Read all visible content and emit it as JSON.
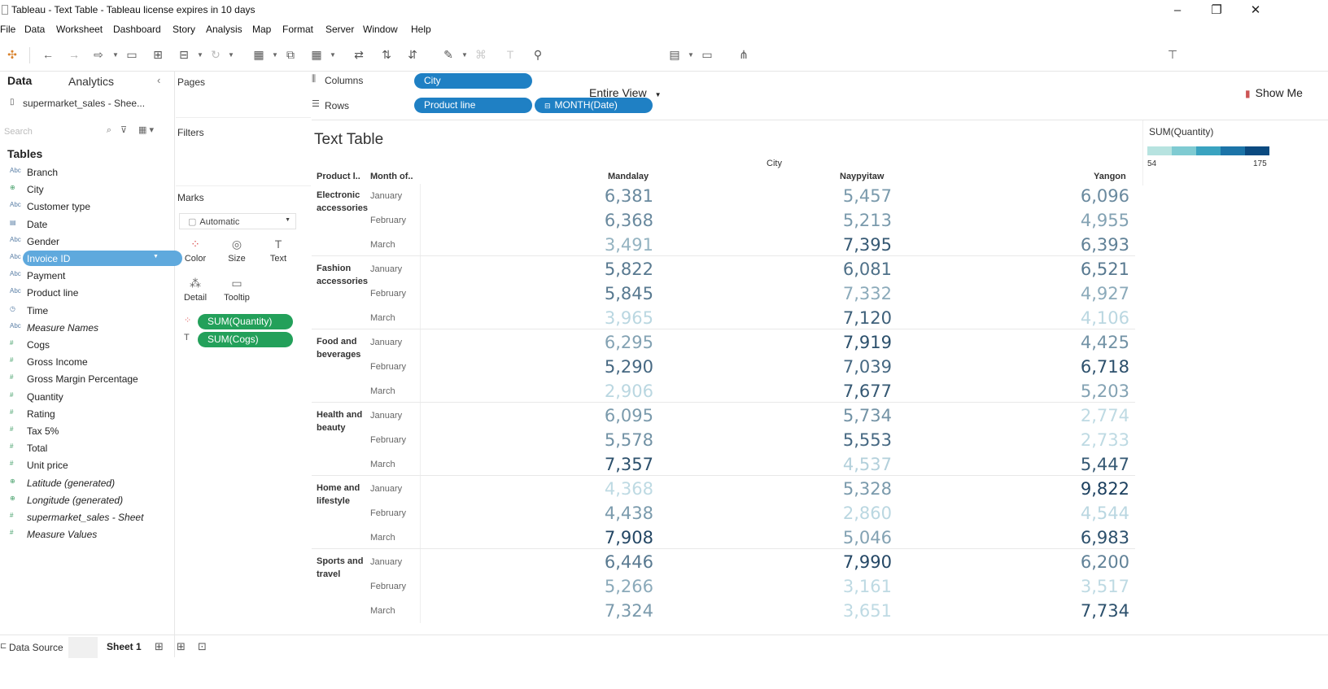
{
  "window": {
    "title": "Tableau - Text Table - Tableau license expires in 10 days",
    "minimize": "–",
    "restore": "❐",
    "close": "✕"
  },
  "menu": [
    "File",
    "Data",
    "Worksheet",
    "Dashboard",
    "Story",
    "Analysis",
    "Map",
    "Format",
    "Server",
    "Window",
    "Help"
  ],
  "toolbar": {
    "fit_label": "Entire View",
    "show_me_label": "Show Me"
  },
  "data_pane": {
    "tab_data": "Data",
    "tab_analytics": "Analytics",
    "collapse": "‹",
    "source": "supermarket_sales - Shee...",
    "search_placeholder": "Search",
    "tables_label": "Tables",
    "fields": [
      {
        "icon": "Abc",
        "label": "Branch",
        "kind": "dimension"
      },
      {
        "icon": "⊕",
        "label": "City",
        "kind": "geo"
      },
      {
        "icon": "Abc",
        "label": "Customer type",
        "kind": "dimension"
      },
      {
        "icon": "▤",
        "label": "Date",
        "kind": "date"
      },
      {
        "icon": "Abc",
        "label": "Gender",
        "kind": "dimension"
      },
      {
        "icon": "Abc",
        "label": "Invoice ID",
        "kind": "dimension",
        "selected": true
      },
      {
        "icon": "Abc",
        "label": "Payment",
        "kind": "dimension"
      },
      {
        "icon": "Abc",
        "label": "Product line",
        "kind": "dimension"
      },
      {
        "icon": "◷",
        "label": "Time",
        "kind": "date"
      },
      {
        "icon": "Abc",
        "label": "Measure Names",
        "kind": "dimension",
        "italic": true
      },
      {
        "icon": "#",
        "label": "Cogs",
        "kind": "measure"
      },
      {
        "icon": "#",
        "label": "Gross Income",
        "kind": "measure"
      },
      {
        "icon": "#",
        "label": "Gross Margin Percentage",
        "kind": "measure"
      },
      {
        "icon": "#",
        "label": "Quantity",
        "kind": "measure"
      },
      {
        "icon": "#",
        "label": "Rating",
        "kind": "measure"
      },
      {
        "icon": "#",
        "label": "Tax 5%",
        "kind": "measure"
      },
      {
        "icon": "#",
        "label": "Total",
        "kind": "measure"
      },
      {
        "icon": "#",
        "label": "Unit price",
        "kind": "measure"
      },
      {
        "icon": "⊕",
        "label": "Latitude (generated)",
        "kind": "geo",
        "italic": true
      },
      {
        "icon": "⊕",
        "label": "Longitude (generated)",
        "kind": "geo",
        "italic": true
      },
      {
        "icon": "#",
        "label": "supermarket_sales - Sheet",
        "kind": "measure",
        "italic": true
      },
      {
        "icon": "#",
        "label": "Measure Values",
        "kind": "measure",
        "italic": true
      }
    ]
  },
  "cards": {
    "pages_label": "Pages",
    "filters_label": "Filters",
    "marks_label": "Marks",
    "mark_type": "Automatic",
    "mark_buttons": [
      {
        "label": "Color",
        "icon": "⁘"
      },
      {
        "label": "Size",
        "icon": "◎"
      },
      {
        "label": "Text",
        "icon": "T"
      },
      {
        "label": "Detail",
        "icon": "⁂"
      },
      {
        "label": "Tooltip",
        "icon": "▭"
      }
    ],
    "mark_pills": [
      "SUM(Quantity)",
      "SUM(Cogs)"
    ]
  },
  "shelves": {
    "columns_label": "Columns",
    "rows_label": "Rows",
    "columns_pills": [
      "City"
    ],
    "rows_pills": [
      "Product line",
      "MONTH(Date)"
    ]
  },
  "view": {
    "sheet_title": "Text Table",
    "column_header_group": "City",
    "row_header_1": "Product l..",
    "row_header_2": "Month of..",
    "cities": [
      "Mandalay",
      "Naypyitaw",
      "Yangon"
    ],
    "groups": [
      {
        "product_line": "Electronic accessories",
        "months": [
          {
            "month": "January",
            "values": [
              "6,381",
              "5,457",
              "6,096"
            ],
            "shades": [
              0.55,
              0.45,
              0.55
            ]
          },
          {
            "month": "February",
            "values": [
              "6,368",
              "5,213",
              "4,955"
            ],
            "shades": [
              0.55,
              0.45,
              0.4
            ]
          },
          {
            "month": "March",
            "values": [
              "3,491",
              "7,395",
              "6,393"
            ],
            "shades": [
              0.3,
              0.85,
              0.6
            ]
          }
        ]
      },
      {
        "product_line": "Fashion accessories",
        "months": [
          {
            "month": "January",
            "values": [
              "5,822",
              "6,081",
              "6,521"
            ],
            "shades": [
              0.65,
              0.7,
              0.65
            ]
          },
          {
            "month": "February",
            "values": [
              "5,845",
              "7,332",
              "4,927"
            ],
            "shades": [
              0.65,
              0.35,
              0.35
            ]
          },
          {
            "month": "March",
            "values": [
              "3,965",
              "7,120",
              "4,106"
            ],
            "shades": [
              0.08,
              0.8,
              0.08
            ]
          }
        ]
      },
      {
        "product_line": "Food and beverages",
        "months": [
          {
            "month": "January",
            "values": [
              "6,295",
              "7,919",
              "4,425"
            ],
            "shades": [
              0.4,
              0.9,
              0.5
            ]
          },
          {
            "month": "February",
            "values": [
              "5,290",
              "7,039",
              "6,718"
            ],
            "shades": [
              0.75,
              0.75,
              0.9
            ]
          },
          {
            "month": "March",
            "values": [
              "2,906",
              "7,677",
              "5,203"
            ],
            "shades": [
              0.08,
              0.85,
              0.4
            ]
          }
        ]
      },
      {
        "product_line": "Health and beauty",
        "months": [
          {
            "month": "January",
            "values": [
              "6,095",
              "5,734",
              "2,774"
            ],
            "shades": [
              0.45,
              0.5,
              0.06
            ]
          },
          {
            "month": "February",
            "values": [
              "5,578",
              "5,553",
              "2,733"
            ],
            "shades": [
              0.5,
              0.75,
              0.06
            ]
          },
          {
            "month": "March",
            "values": [
              "7,357",
              "4,537",
              "5,447"
            ],
            "shades": [
              0.9,
              0.12,
              0.85
            ]
          }
        ]
      },
      {
        "product_line": "Home and lifestyle",
        "months": [
          {
            "month": "January",
            "values": [
              "4,368",
              "5,328",
              "9,822"
            ],
            "shades": [
              0.06,
              0.45,
              1.0
            ]
          },
          {
            "month": "February",
            "values": [
              "4,438",
              "2,860",
              "4,544"
            ],
            "shades": [
              0.45,
              0.08,
              0.08
            ]
          },
          {
            "month": "March",
            "values": [
              "7,908",
              "5,046",
              "6,983"
            ],
            "shades": [
              0.95,
              0.4,
              0.9
            ]
          }
        ]
      },
      {
        "product_line": "Sports and travel",
        "months": [
          {
            "month": "January",
            "values": [
              "6,446",
              "7,990",
              "6,200"
            ],
            "shades": [
              0.65,
              0.95,
              0.6
            ]
          },
          {
            "month": "February",
            "values": [
              "5,266",
              "3,161",
              "3,517"
            ],
            "shades": [
              0.35,
              0.06,
              0.06
            ]
          },
          {
            "month": "March",
            "values": [
              "7,324",
              "3,651",
              "7,734"
            ],
            "shades": [
              0.45,
              0.06,
              0.9
            ]
          }
        ]
      }
    ]
  },
  "legend": {
    "title": "SUM(Quantity)",
    "min": "54",
    "max": "175",
    "colors": [
      "#b7e3e0",
      "#7fcbd2",
      "#3aa3c0",
      "#1c74a8",
      "#0b4a80"
    ]
  },
  "bottom": {
    "data_source_label": "Data Source",
    "sheet_tab": "Sheet 1"
  },
  "colors": {
    "accent_blue": "#1f80c4",
    "measure_green": "#23a05a",
    "selected_field": "#5fa9dd",
    "value_dark": "#1b3f5e",
    "value_light": "#c8e4ec"
  }
}
